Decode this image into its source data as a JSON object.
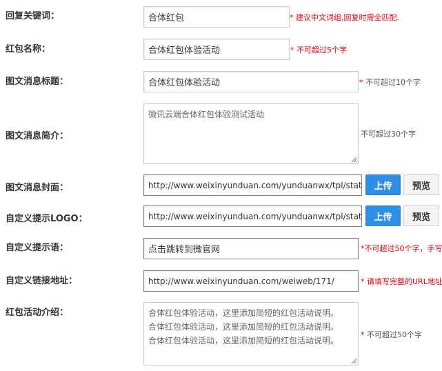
{
  "fields": {
    "keyword": {
      "label": "回复关键词：",
      "value": "合体红包",
      "hint": "* 建议中文词组,回复时需全匹配."
    },
    "name": {
      "label": "红包名称：",
      "value": "合体红包体验活动",
      "hint": "* 不可超过5个字"
    },
    "news_title": {
      "label": "图文消息标题：",
      "value": "合体红包体验活动",
      "hint_star": "*",
      "hint_text": " 不可超过10个字"
    },
    "news_intro": {
      "label": "图文消息简介：",
      "value": "微讯云端合体红包体验测试活动",
      "hint": "不可超过30个字"
    },
    "news_cover": {
      "label": "图文消息封面：",
      "value": "http://www.weixinyunduan.com/yunduanwx/tpl/static/",
      "upload": "上传",
      "preview": "预览"
    },
    "logo": {
      "label": "自定义提示LOGO：",
      "value": "http://www.weixinyunduan.com/yunduanwx/tpl/static/",
      "upload": "上传",
      "preview": "预览"
    },
    "tip": {
      "label": "自定义提示语：",
      "value": "点击跳转到微官网",
      "hint": "*不可超过50个字，手写"
    },
    "link": {
      "label": "自定义链接地址：",
      "value": "http://www.weixinyunduan.com/weiweb/171/",
      "hint": "* 请填写完整的URL地址"
    },
    "intro": {
      "label": "红包活动介绍：",
      "lines": [
        "合体红包体验活动，这里添加简短的红包活动说明。",
        "合体红包体验活动，这里添加简短的红包活动说明。",
        "合体红包体验活动，这里添加简短的红包活动说明。"
      ],
      "hint_star": "*",
      "hint_text": " 不可超过50个字"
    }
  },
  "colors": {
    "accent": "#2f8fe6",
    "required": "#e60012"
  }
}
